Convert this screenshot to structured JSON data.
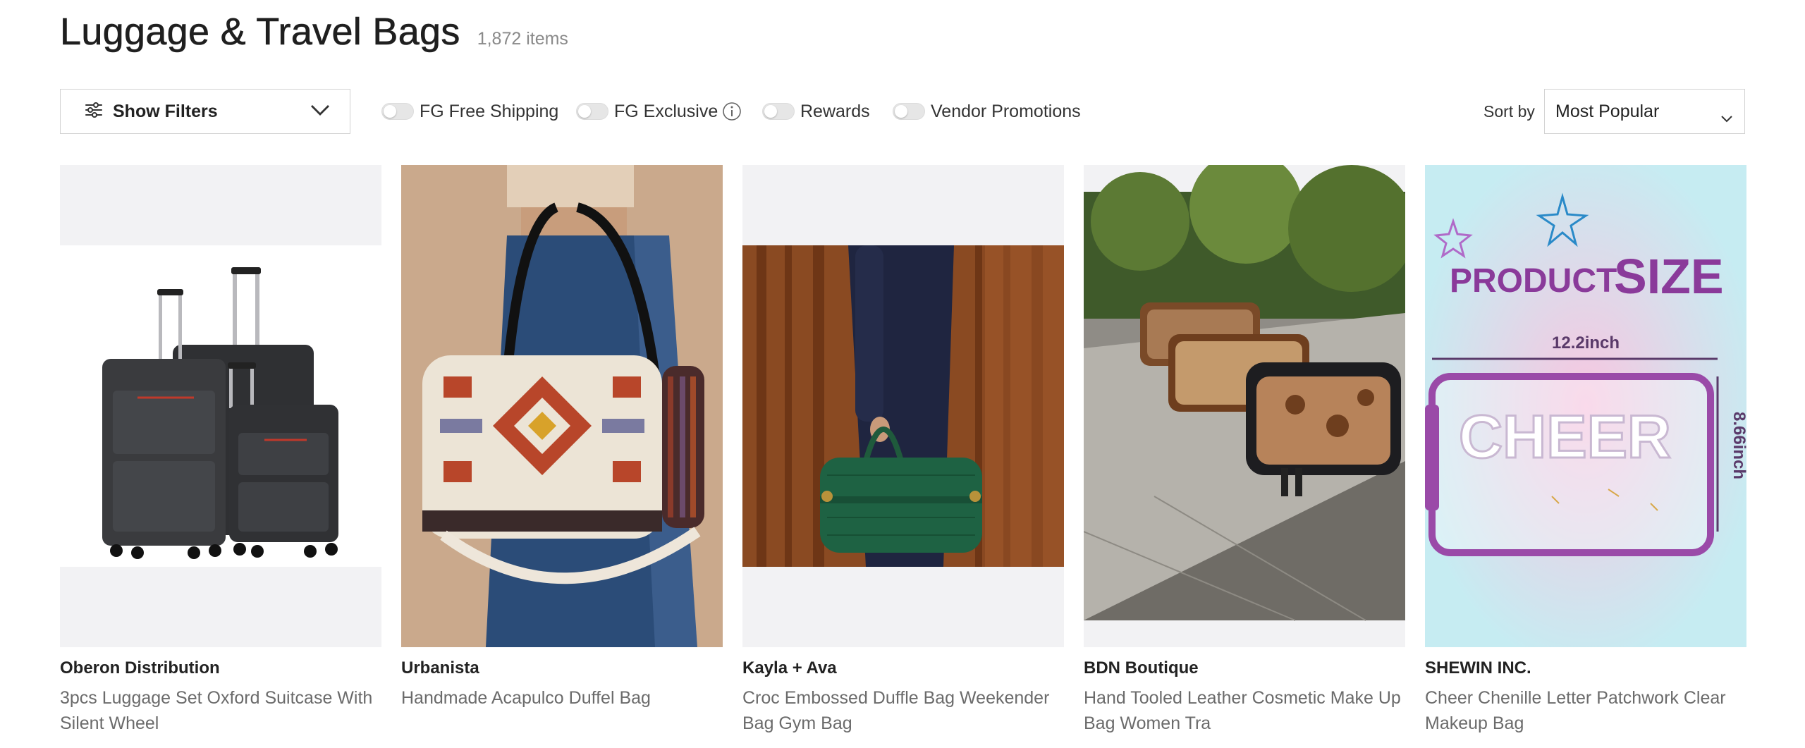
{
  "page": {
    "title": "Luggage & Travel Bags",
    "item_count": "1,872 items"
  },
  "toolbar": {
    "filters_label": "Show Filters",
    "toggles": [
      {
        "label": "FG Free Shipping",
        "on": false
      },
      {
        "label": "FG Exclusive",
        "on": false,
        "has_info_icon": true
      },
      {
        "label": "Rewards",
        "on": false
      },
      {
        "label": "Vendor Promotions",
        "on": false
      }
    ],
    "sort_label": "Sort by",
    "sort_value": "Most Popular"
  },
  "products": [
    {
      "brand": "Oberon Distribution",
      "name": "3pcs Luggage Set Oxford Suitcase With Silent Wheel",
      "image": "luggage-set-photo"
    },
    {
      "brand": "Urbanista",
      "name": "Handmade Acapulco Duffel Bag",
      "image": "aztec-duffel-photo"
    },
    {
      "brand": "Kayla + Ava",
      "name": "Croc Embossed Duffle Bag Weekender Bag Gym Bag",
      "image": "green-croc-duffle-photo"
    },
    {
      "brand": "BDN Boutique",
      "name": "Hand Tooled Leather Cosmetic Make Up Bag Women Tra",
      "image": "tooled-leather-bags-photo"
    },
    {
      "brand": "SHEWIN INC.",
      "name": "Cheer Chenille Letter Patchwork Clear Makeup Bag",
      "image": "cheer-pouch-photo",
      "image_text": {
        "headline_a": "PRODUCT",
        "headline_b": "SIZE",
        "width": "12.2inch",
        "height": "8.66inch",
        "patch": "CHEER"
      }
    }
  ],
  "colors": {
    "toggle_off": "#e6e6e6",
    "border": "#d2d2d2",
    "thumb_bg": "#f2f2f4",
    "muted_text": "#6b6b6b"
  }
}
